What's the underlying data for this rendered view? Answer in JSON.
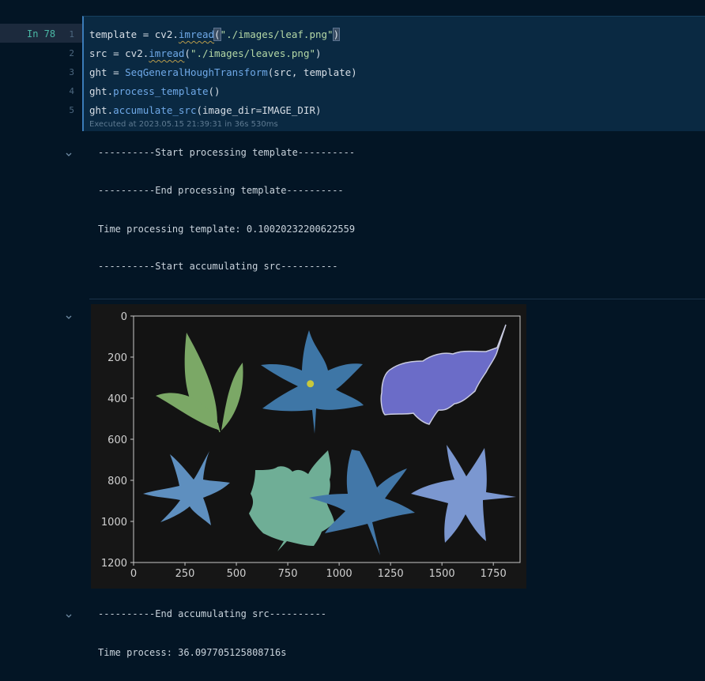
{
  "cell": {
    "execution_label": "In 78",
    "lines": [
      {
        "number": "1",
        "parts": [
          [
            "template = cv2.",
            ""
          ],
          [
            "imread",
            "fn-u"
          ],
          [
            "(",
            "paren"
          ],
          [
            "\"./images/leaf.png\"",
            "str"
          ],
          [
            ")",
            "paren"
          ]
        ]
      },
      {
        "number": "2",
        "parts": [
          [
            "src = cv2.",
            ""
          ],
          [
            "imread",
            "fn-u"
          ],
          [
            "(",
            ""
          ],
          [
            "\"./images/leaves.png\"",
            "str"
          ],
          [
            ")",
            ""
          ]
        ]
      },
      {
        "number": "3",
        "parts": [
          [
            "ght = ",
            ""
          ],
          [
            "SeqGeneralHoughTransform",
            "fn"
          ],
          [
            "(src, template)",
            ""
          ]
        ]
      },
      {
        "number": "4",
        "parts": [
          [
            "ght.",
            ""
          ],
          [
            "process_template",
            "fn"
          ],
          [
            "()",
            ""
          ]
        ]
      },
      {
        "number": "5",
        "parts": [
          [
            "ght.",
            ""
          ],
          [
            "accumulate_src",
            "fn"
          ],
          [
            "(image_dir=IMAGE_DIR)",
            ""
          ]
        ]
      }
    ],
    "executed_info": "Executed at 2023.05.15 21:39:31 in 36s 530ms"
  },
  "output_block_1": [
    "----------Start processing template----------",
    "----------End processing template----------",
    "Time processing template: 0.10020232200622559",
    "----------Start accumulating src----------"
  ],
  "output_block_2": [
    "----------End accumulating src----------",
    "Time process: 36.097705125808716s"
  ],
  "chart_data": {
    "type": "image",
    "x_ticks": [
      "0",
      "250",
      "500",
      "750",
      "1000",
      "1250",
      "1500",
      "1750"
    ],
    "y_ticks": [
      "0",
      "200",
      "400",
      "600",
      "800",
      "1000",
      "1200"
    ],
    "xlim": [
      0,
      1880
    ],
    "ylim": [
      1200,
      0
    ],
    "detected_point": {
      "x": 860,
      "y": 330,
      "color": "#c8c83c"
    },
    "leaf_colors": [
      "#7ba866",
      "#3e76a6",
      "#6b6cc8",
      "#5e8fbf",
      "#6fae96",
      "#4277a8",
      "#7b97d0"
    ]
  }
}
